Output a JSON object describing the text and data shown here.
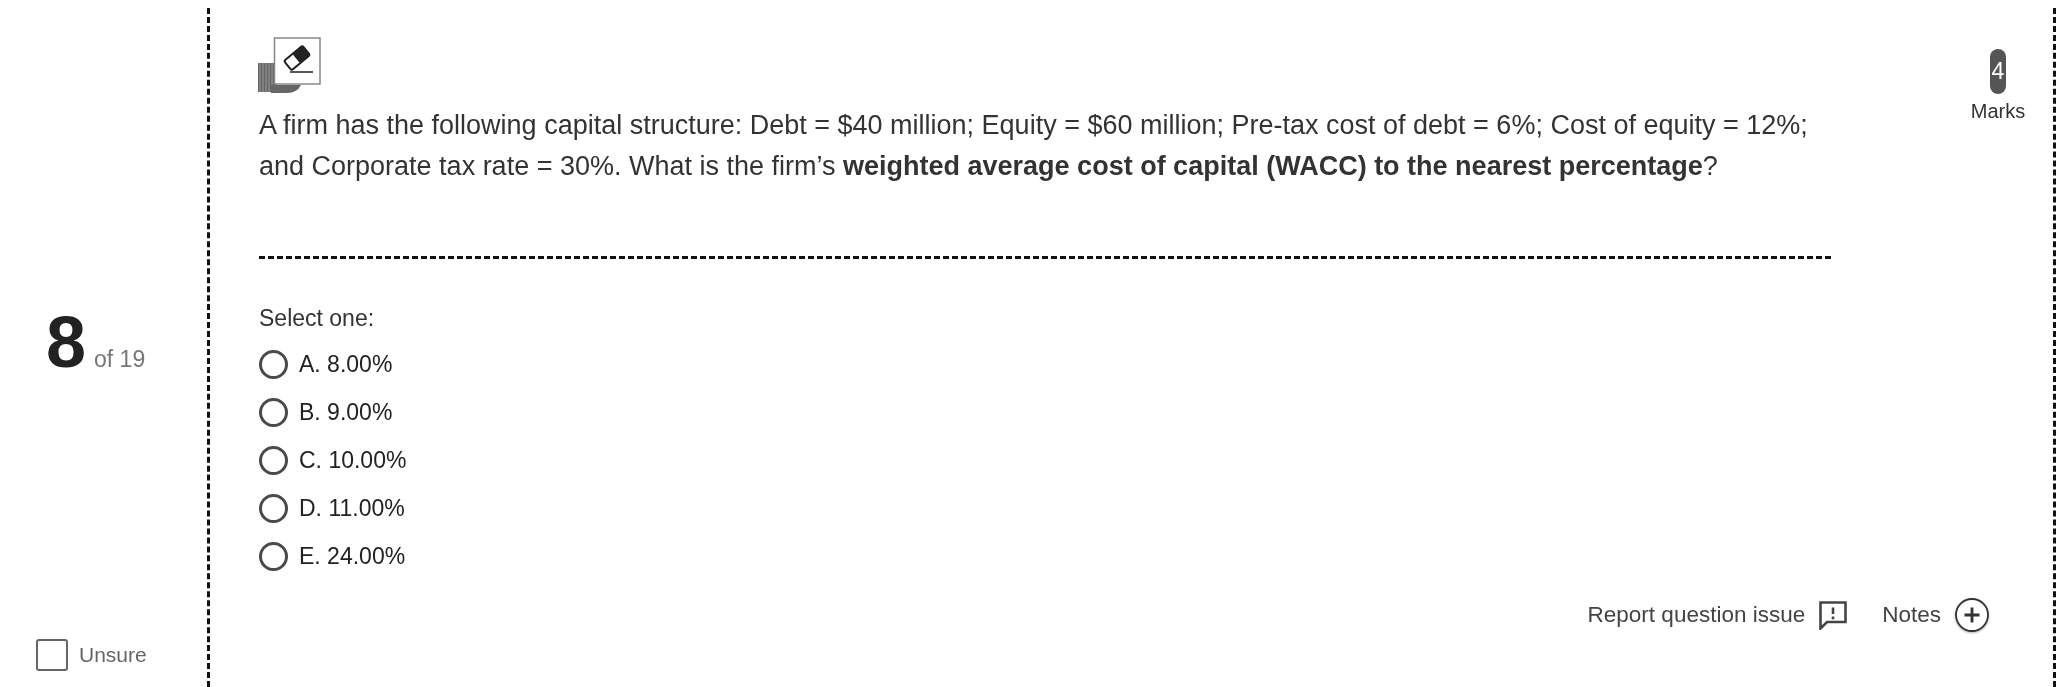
{
  "sidebar": {
    "question_number": "8",
    "question_total": "of 19",
    "unsure": {
      "label": "Unsure",
      "checked": false
    }
  },
  "question": {
    "text": "A firm has the following capital structure: Debt = $40 million; Equity = $60 million; Pre-tax cost of debt = 6%; Cost of equity = 12%; and Corporate tax rate = 30%. What is the firm’s **weighted average cost of capital (WACC) to the nearest percentage**?",
    "marks": "4",
    "marks_label": "Marks"
  },
  "answer": {
    "prompt": "Select one:",
    "options": [
      {
        "label": "A. 8.00%",
        "selected": false
      },
      {
        "label": "B. 9.00%",
        "selected": false
      },
      {
        "label": "C. 10.00%",
        "selected": false
      },
      {
        "label": "D. 11.00%",
        "selected": false
      },
      {
        "label": "E. 24.00%",
        "selected": false
      }
    ]
  },
  "footer": {
    "report": "Report question issue",
    "notes": "Notes"
  }
}
